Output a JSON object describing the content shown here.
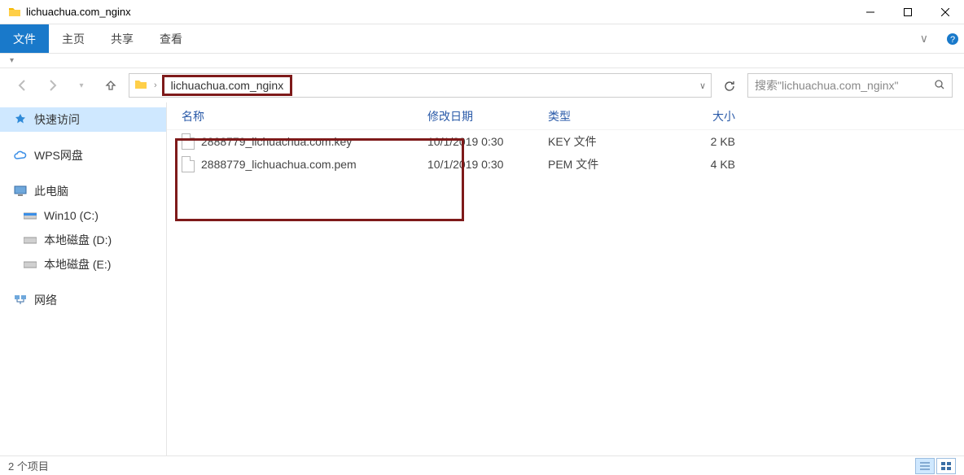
{
  "window": {
    "title": "lichuachua.com_nginx"
  },
  "ribbon": {
    "file": "文件",
    "home": "主页",
    "share": "共享",
    "view": "查看"
  },
  "address": {
    "crumb": "lichuachua.com_nginx"
  },
  "search": {
    "placeholder": "搜索\"lichuachua.com_nginx\""
  },
  "sidebar": {
    "quick": "快速访问",
    "wps": "WPS网盘",
    "pc": "此电脑",
    "drives": [
      "Win10 (C:)",
      "本地磁盘 (D:)",
      "本地磁盘 (E:)"
    ],
    "network": "网络"
  },
  "columns": {
    "name": "名称",
    "date": "修改日期",
    "type": "类型",
    "size": "大小"
  },
  "files": [
    {
      "name": "2888779_lichuachua.com.key",
      "date": "10/1/2019 0:30",
      "type": "KEY 文件",
      "size": "2 KB"
    },
    {
      "name": "2888779_lichuachua.com.pem",
      "date": "10/1/2019 0:30",
      "type": "PEM 文件",
      "size": "4 KB"
    }
  ],
  "status": "2 个项目"
}
